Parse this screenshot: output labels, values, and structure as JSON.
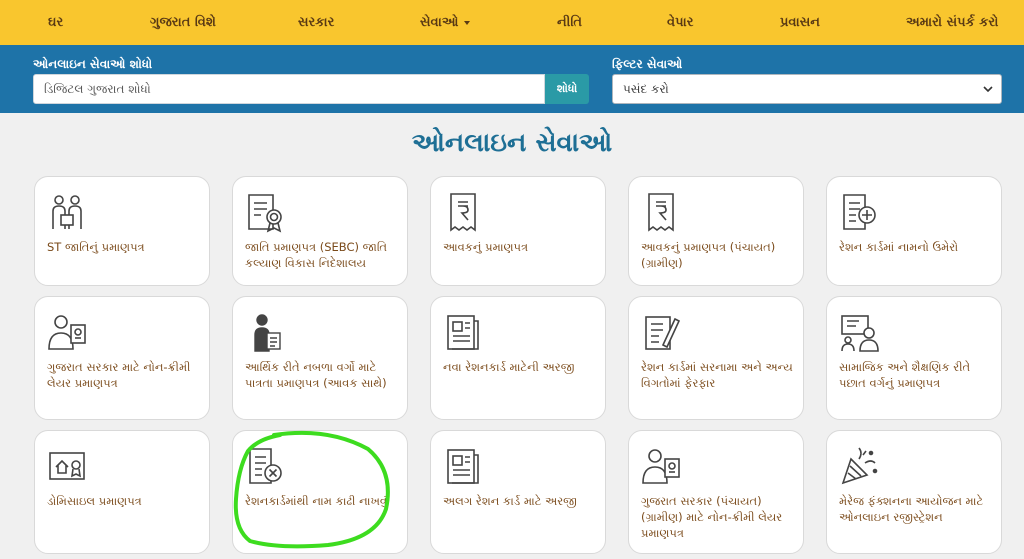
{
  "nav": {
    "items": [
      "ઘર",
      "ગુજરાત વિશે",
      "સરકાર",
      "સેવાઓ",
      "નીતિ",
      "વેપાર",
      "પ્રવાસન",
      "અમારો સંપર્ક કરો"
    ]
  },
  "search": {
    "label": "ઓનલાઇન સેવાઓ શોધો",
    "placeholder": "ડિજિટલ ગુજરાત શોધો",
    "button": "શોધો"
  },
  "filter": {
    "label": "ફિલ્ટર સેવાઓ",
    "selected": "પસંદ કરો"
  },
  "page_title": "ઓનલાઇન સેવાઓ",
  "services": [
    {
      "label": "ST જાતિનું પ્રમાણપત્ર",
      "icon": "people-certificate-icon"
    },
    {
      "label": "જાતિ પ્રમાણપત્ર (SEBC) જાતિ કલ્યાણ વિકાસ નિદેશાલય",
      "icon": "certificate-seal-icon"
    },
    {
      "label": "આવકનું પ્રમાણપત્ર",
      "icon": "rupee-receipt-icon"
    },
    {
      "label": "આવકનું પ્રમાણપત્ર (પંચાયત) (ગ્રામીણ)",
      "icon": "rupee-receipt-icon"
    },
    {
      "label": "રેશન કાર્ડમાં નામનો ઉમેરો",
      "icon": "add-document-icon"
    },
    {
      "label": "ગુજરાત સરકાર માટે નોન-ક્રીમી લેયર પ્રમાણપત્ર",
      "icon": "person-certificate-icon"
    },
    {
      "label": "આર્થિક રીતે નબળા વર્ગો માટે પાત્રતા પ્રમાણપત્ર (આવક સાથે)",
      "icon": "person-document-icon"
    },
    {
      "label": "નવા રેશનકાર્ડ માટેની અરજી",
      "icon": "newspaper-icon"
    },
    {
      "label": "રેશન કાર્ડમાં સરનામા અને અન્ય વિગતોમાં ફેરફાર",
      "icon": "edit-document-icon"
    },
    {
      "label": "સામાજિક અને શૈક્ષણિક રીતે પછાત વર્ગનું પ્રમાણપત્ર",
      "icon": "teacher-board-icon"
    },
    {
      "label": "ડોમિસાઇલ પ્રમાણપત્ર",
      "icon": "home-certificate-icon"
    },
    {
      "label": "રેશનકાર્ડમાંથી નામ કાઢી નાખવું",
      "icon": "remove-document-icon"
    },
    {
      "label": "અલગ રેશન કાર્ડ માટે અરજી",
      "icon": "newspaper-icon"
    },
    {
      "label": "ગુજરાત સરકાર (પંચાયત) (ગ્રામીણ) માટે નોન-ક્રીમી લેયર પ્રમાણપત્ર",
      "icon": "person-certificate-icon"
    },
    {
      "label": "મેરેજ ફંક્શનના આયોજન માટે ઓનલાઇન રજીસ્ટ્રેશન",
      "icon": "party-popper-icon"
    }
  ],
  "colors": {
    "nav_bg": "#f9c62e",
    "search_bg": "#1e73a8",
    "title": "#1e6f95",
    "card_text": "#7a4a1a",
    "highlight": "#3ddc1f"
  }
}
